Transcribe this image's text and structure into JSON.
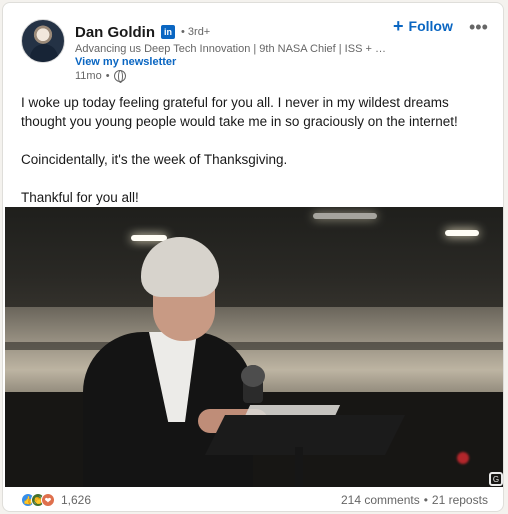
{
  "author": {
    "name": "Dan Goldin",
    "badge": "in",
    "degree": "• 3rd+",
    "headline": "Advancing us Deep Tech Innovation | 9th NASA Chief | ISS + We...",
    "newsletter_link": "View my newsletter",
    "time": "11mo",
    "meta_separator": "•",
    "visibility_icon": "globe-icon"
  },
  "actions": {
    "follow_label": "Follow",
    "follow_icon": "+",
    "more_icon": "•••"
  },
  "post": {
    "paragraphs": [
      "I woke up today feeling grateful for you all. I never in my wildest dreams thought you young people would take me in so graciously on the internet!",
      "Coincidentally, it's the week of Thanksgiving.",
      "Thankful for you all!"
    ]
  },
  "media": {
    "watermark": "G"
  },
  "social": {
    "reactions": [
      "like-icon",
      "celebrate-icon",
      "love-icon"
    ],
    "reaction_count": "1,626",
    "comments": "214 comments",
    "separator": "•",
    "reposts": "21 reposts"
  },
  "colors": {
    "accent": "#0a66c2",
    "muted_text": "#666666",
    "primary_text": "#191919"
  }
}
